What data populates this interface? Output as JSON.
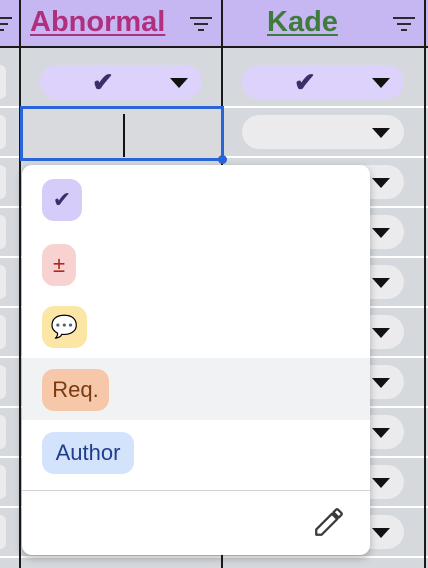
{
  "columns": [
    {
      "name": "Abnormal",
      "color": "#b0307f"
    },
    {
      "name": "Kade",
      "color": "#3f7a3f"
    }
  ],
  "first_row": {
    "left_value": "✔",
    "right_value": "✔"
  },
  "dropdown": {
    "options": [
      {
        "label": "✔",
        "bg": "#d6ccfa",
        "fg": "#3d2e6a"
      },
      {
        "label": "±",
        "bg": "#f8d2d0",
        "fg": "#b3261e"
      },
      {
        "label": "💬",
        "bg": "#fbe6a6",
        "fg": "#555555"
      },
      {
        "label": "Req.",
        "bg": "#f6c7a8",
        "fg": "#7a3a12"
      },
      {
        "label": "Author",
        "bg": "#d3e3fc",
        "fg": "#1f3e8c"
      }
    ],
    "highlighted_index": 3,
    "edit_icon": "pencil-icon"
  }
}
